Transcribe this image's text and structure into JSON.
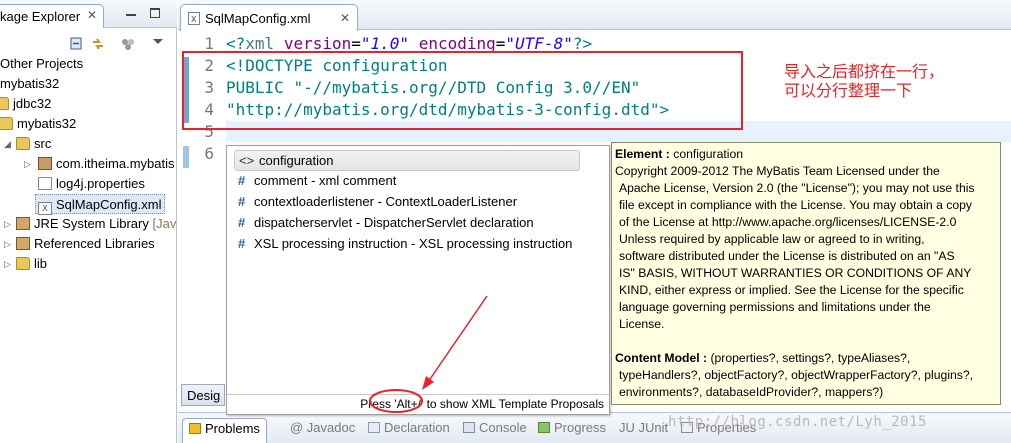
{
  "package_explorer": {
    "tab_label": "kage Explorer",
    "tree": [
      {
        "label": "Other Projects"
      },
      {
        "label": "mybatis32"
      },
      {
        "label": "jdbc32"
      },
      {
        "label": "mybatis32"
      },
      {
        "label": "src"
      },
      {
        "label": "com.itheima.mybatis"
      },
      {
        "label": "log4j.properties"
      },
      {
        "label": "SqlMapConfig.xml"
      },
      {
        "label": "JRE System Library",
        "suffix": "[Jav"
      },
      {
        "label": "Referenced Libraries"
      },
      {
        "label": "lib"
      }
    ]
  },
  "editor": {
    "tab_label": "SqlMapConfig.xml",
    "line_numbers": [
      "1",
      "2",
      "3",
      "4",
      "5",
      "6"
    ],
    "lines": {
      "l1_a": "<?",
      "l1_tag": "xml",
      "l1_sp1": " ",
      "l1_attr1": "version",
      "l1_eq1": "=",
      "l1_val1": "\"1.0\"",
      "l1_sp2": " ",
      "l1_attr2": "encoding",
      "l1_eq2": "=",
      "l1_val2": "\"UTF-8\"",
      "l1_end": "?>",
      "l2": "<!DOCTYPE configuration",
      "l3_a": "PUBLIC ",
      "l3_b": "\"-//mybatis.org//DTD Config 3.0//EN\"",
      "l4": "\"http://mybatis.org/dtd/mybatis-3-config.dtd\">"
    },
    "annotation": [
      "导入之后都挤在一行，",
      "可以分行整理一下"
    ]
  },
  "content_assist": {
    "items": [
      {
        "icon": "<>",
        "label": "configuration"
      },
      {
        "icon": "#",
        "label": "comment - xml comment"
      },
      {
        "icon": "#",
        "label": "contextloaderlistener - ContextLoaderListener"
      },
      {
        "icon": "#",
        "label": "dispatcherservlet - DispatcherServlet declaration"
      },
      {
        "icon": "#",
        "label": "XSL processing instruction - XSL processing instruction"
      }
    ],
    "status": "Press 'Alt+/' to show XML Template Proposals"
  },
  "doc_popup": {
    "element_label": "Element :",
    "element_value": " configuration",
    "copyright": "Copyright 2009-2012 The MyBatis Team Licensed under the",
    "license_lines": [
      "Apache License, Version 2.0 (the \"License\"); you may not use this",
      "file except in compliance with the License. You may obtain a copy",
      "of the License at http://www.apache.org/licenses/LICENSE-2.0",
      "Unless required by applicable law or agreed to in writing,",
      "software distributed under the License is distributed on an \"AS",
      "IS\" BASIS, WITHOUT WARRANTIES OR CONDITIONS OF ANY",
      "KIND, either express or implied. See the License for the specific",
      "language governing permissions and limitations under the",
      "License."
    ],
    "content_model_label": "Content Model :",
    "content_model_lines": [
      " (properties?, settings?, typeAliases?,",
      "typeHandlers?, objectFactory?, objectWrapperFactory?, plugins?,",
      "environments?, databaseIdProvider?, mappers?)"
    ]
  },
  "design_tab": "Desig",
  "bottom_tabs": [
    "Problems",
    "@ Javadoc",
    "Declaration",
    "Console",
    "Progress",
    "JU JUnit",
    "Properties"
  ],
  "watermark": "http://blog.csdn.net/Lyh_2015",
  "colors": {
    "annotation_red": "#e8222a",
    "popup_yellow": "#ffffe1",
    "xml_string_blue": "#2a00ff",
    "doctype_teal": "#008080"
  }
}
